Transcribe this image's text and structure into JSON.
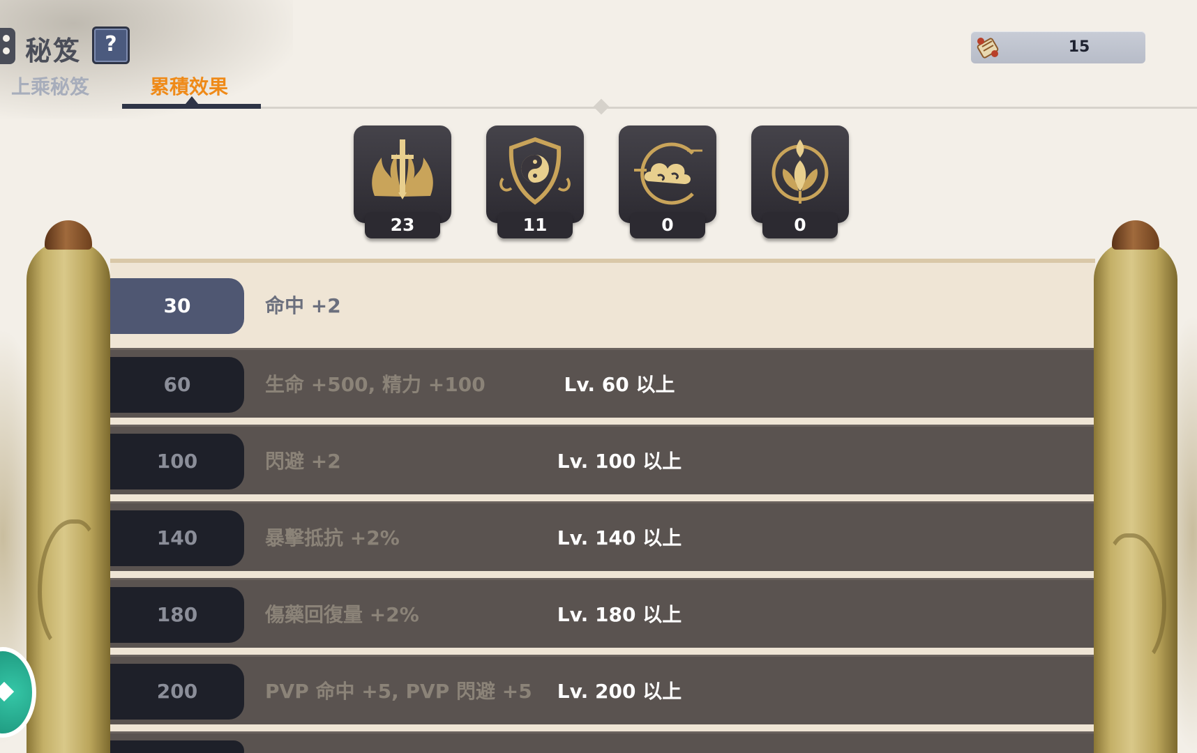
{
  "header": {
    "title": "秘笈",
    "help_label": "?",
    "tabs": [
      {
        "label": "上乘秘笈",
        "selected": false
      },
      {
        "label": "累積效果",
        "selected": true
      }
    ],
    "currency": {
      "icon": "scroll-currency-icon",
      "value": "15"
    }
  },
  "categories": [
    {
      "icon": "sword-flame-icon",
      "count": "23"
    },
    {
      "icon": "yin-yang-shield-icon",
      "count": "11"
    },
    {
      "icon": "cloud-swirl-icon",
      "count": "0"
    },
    {
      "icon": "lotus-flame-icon",
      "count": "0"
    }
  ],
  "effects": [
    {
      "threshold": "30",
      "effect": "命中 +2",
      "requirement": "",
      "state": "active"
    },
    {
      "threshold": "60",
      "effect": "生命 +500, 精力 +100",
      "requirement": "Lv. 60 以上",
      "state": "locked"
    },
    {
      "threshold": "100",
      "effect": "閃避 +2",
      "requirement": "Lv. 100 以上",
      "state": "locked"
    },
    {
      "threshold": "140",
      "effect": "暴擊抵抗 +2%",
      "requirement": "Lv. 140 以上",
      "state": "locked"
    },
    {
      "threshold": "180",
      "effect": "傷藥回復量 +2%",
      "requirement": "Lv. 180 以上",
      "state": "locked"
    },
    {
      "threshold": "200",
      "effect": "PVP 命中 +5, PVP 閃避 +5",
      "requirement": "Lv. 200 以上",
      "state": "locked"
    }
  ],
  "colors": {
    "accent_tab": "#ef8a18",
    "active_badge": "#4f5772",
    "locked_row": "#5a5350",
    "paper": "#efe5d5"
  }
}
